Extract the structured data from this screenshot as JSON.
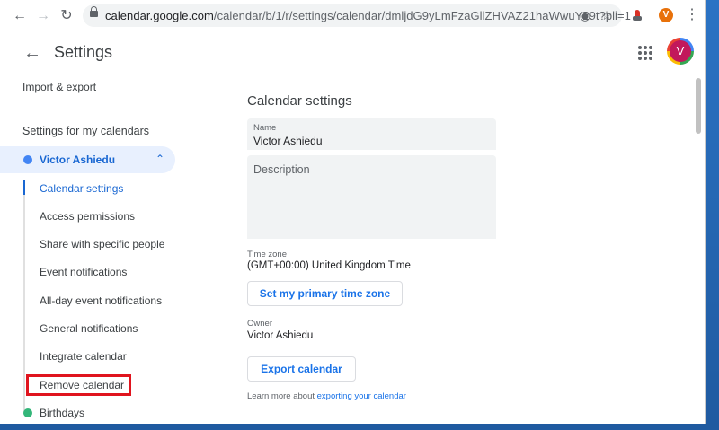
{
  "browser": {
    "url_host": "calendar.google.com",
    "url_path": "/calendar/b/1/r/settings/calendar/dmljdG9yLmFzaGllZHVAZ21haWwuY29t?pli=1",
    "profile_initial": "V"
  },
  "header": {
    "title": "Settings",
    "avatar_initial": "V"
  },
  "sidebar": {
    "import_export": "Import & export",
    "my_calendars_heading": "Settings for my calendars",
    "calendar_name": "Victor Ashiedu",
    "calendar_color": "#4285f4",
    "sub_items": [
      "Calendar settings",
      "Access permissions",
      "Share with specific people",
      "Event notifications",
      "All-day event notifications",
      "General notifications",
      "Integrate calendar",
      "Remove calendar"
    ],
    "other_calendar": "Birthdays",
    "other_calendar_color": "#33b679"
  },
  "main": {
    "section_title": "Calendar settings",
    "name_label": "Name",
    "name_value": "Victor Ashiedu",
    "description_placeholder": "Description",
    "timezone_label": "Time zone",
    "timezone_value": "(GMT+00:00) United Kingdom Time",
    "set_primary_tz_button": "Set my primary time zone",
    "owner_label": "Owner",
    "owner_value": "Victor Ashiedu",
    "export_button": "Export calendar",
    "learn_more_text": "Learn more about",
    "learn_more_link": "exporting your calendar"
  },
  "colors": {
    "accent": "#1a73e8",
    "highlight_box": "#e0141e"
  }
}
